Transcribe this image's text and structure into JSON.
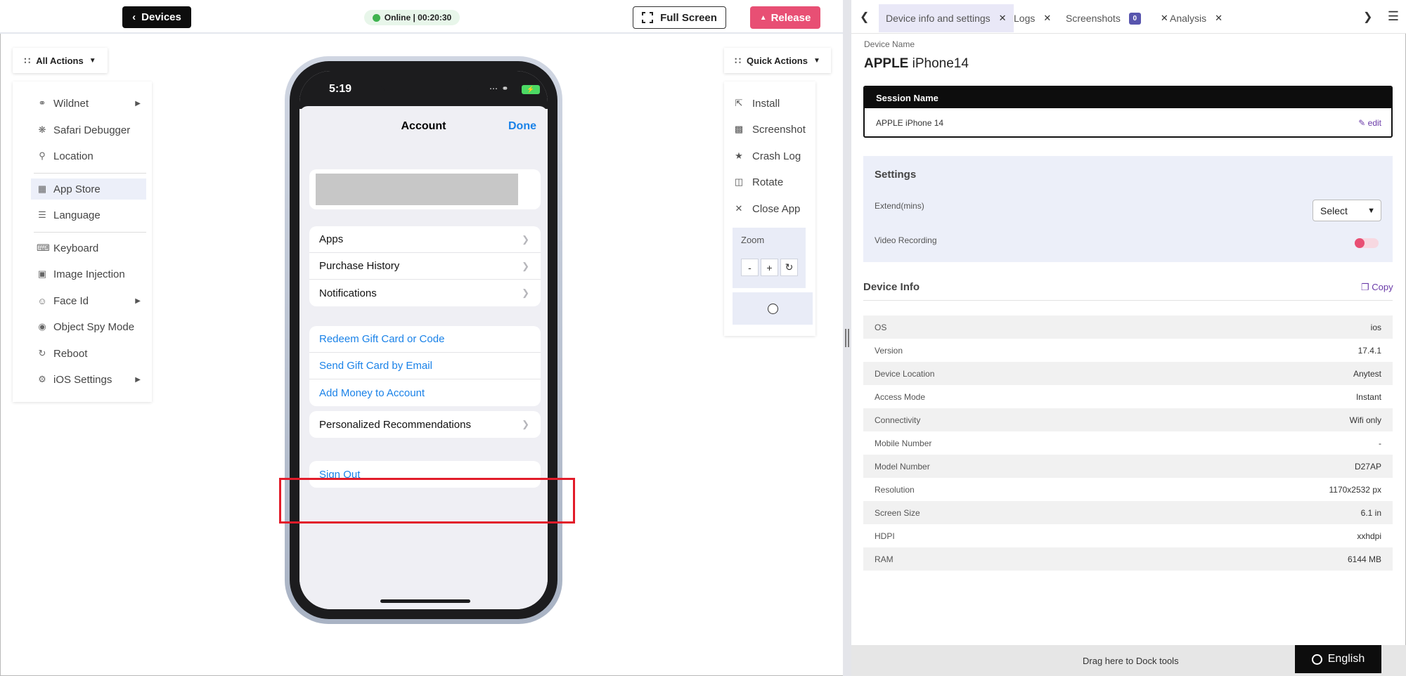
{
  "topbar": {
    "devices_label": "Devices",
    "status_text": "Online | 00:20:30",
    "fullscreen_label": "Full Screen",
    "release_label": "Release"
  },
  "left_actions": {
    "button_label": "All Actions",
    "items": [
      {
        "label": "Wildnet",
        "icon": "wifi-icon",
        "has_submenu": true
      },
      {
        "label": "Safari Debugger",
        "icon": "bug-icon",
        "has_submenu": false
      },
      {
        "label": "Location",
        "icon": "location-pin-icon",
        "has_submenu": false
      },
      {
        "label": "App Store",
        "icon": "apps-grid-icon",
        "has_submenu": false,
        "active": true
      },
      {
        "label": "Language",
        "icon": "language-icon",
        "has_submenu": false
      },
      {
        "label": "Keyboard",
        "icon": "keyboard-icon",
        "has_submenu": false
      },
      {
        "label": "Image Injection",
        "icon": "image-icon",
        "has_submenu": false
      },
      {
        "label": "Face Id",
        "icon": "face-id-icon",
        "has_submenu": true
      },
      {
        "label": "Object Spy Mode",
        "icon": "spy-icon",
        "has_submenu": false
      },
      {
        "label": "Reboot",
        "icon": "reboot-icon",
        "has_submenu": false
      },
      {
        "label": "iOS Settings",
        "icon": "gear-icon",
        "has_submenu": true
      }
    ]
  },
  "phone": {
    "time": "5:19",
    "sheet_title": "Account",
    "done_label": "Done",
    "group1": [
      "Apps",
      "Purchase History",
      "Notifications"
    ],
    "group2": [
      "Redeem Gift Card or Code",
      "Send Gift Card by Email",
      "Add Money to Account"
    ],
    "group3": [
      "Personalized Recommendations"
    ],
    "sign_out": "Sign Out"
  },
  "quick_actions": {
    "button_label": "Quick Actions",
    "items": [
      {
        "label": "Install",
        "icon": "install-icon"
      },
      {
        "label": "Screenshot",
        "icon": "screenshot-icon"
      },
      {
        "label": "Crash Log",
        "icon": "crash-log-icon"
      },
      {
        "label": "Rotate",
        "icon": "rotate-icon"
      },
      {
        "label": "Close App",
        "icon": "close-icon"
      }
    ],
    "zoom_label": "Zoom",
    "zoom_minus": "-",
    "zoom_plus": "+"
  },
  "right_panel": {
    "tabs": [
      {
        "label": "Device info and settings",
        "active": true
      },
      {
        "label": "Logs"
      },
      {
        "label": "Screenshots",
        "badge": "0"
      },
      {
        "label": "Analysis"
      }
    ],
    "device_name_label": "Device Name",
    "device_brand": "APPLE",
    "device_model": "iPhone14",
    "session_label": "Session Name",
    "session_value": "APPLE iPhone 14",
    "edit_label": "edit",
    "settings_title": "Settings",
    "extend_label": "Extend(mins)",
    "extend_select": "Select",
    "video_label": "Video Recording",
    "video_recording_on": false,
    "device_info_title": "Device Info",
    "copy_label": "Copy",
    "info_rows": [
      {
        "key": "OS",
        "value": "ios"
      },
      {
        "key": "Version",
        "value": "17.4.1"
      },
      {
        "key": "Device Location",
        "value": "Anytest"
      },
      {
        "key": "Access Mode",
        "value": "Instant"
      },
      {
        "key": "Connectivity",
        "value": "Wifi only"
      },
      {
        "key": "Mobile Number",
        "value": "-"
      },
      {
        "key": "Model Number",
        "value": "D27AP"
      },
      {
        "key": "Resolution",
        "value": "1170x2532 px"
      },
      {
        "key": "Screen Size",
        "value": "6.1 in"
      },
      {
        "key": "HDPI",
        "value": "xxhdpi"
      },
      {
        "key": "RAM",
        "value": "6144 MB"
      }
    ],
    "dock_text": "Drag here to Dock tools",
    "language_label": "English"
  },
  "colors": {
    "accent_purple": "#5855ae",
    "release_pink": "#e84f74",
    "ios_blue": "#1a82e8",
    "highlight_red": "#e21c2a",
    "online_green": "#3fb34f"
  }
}
